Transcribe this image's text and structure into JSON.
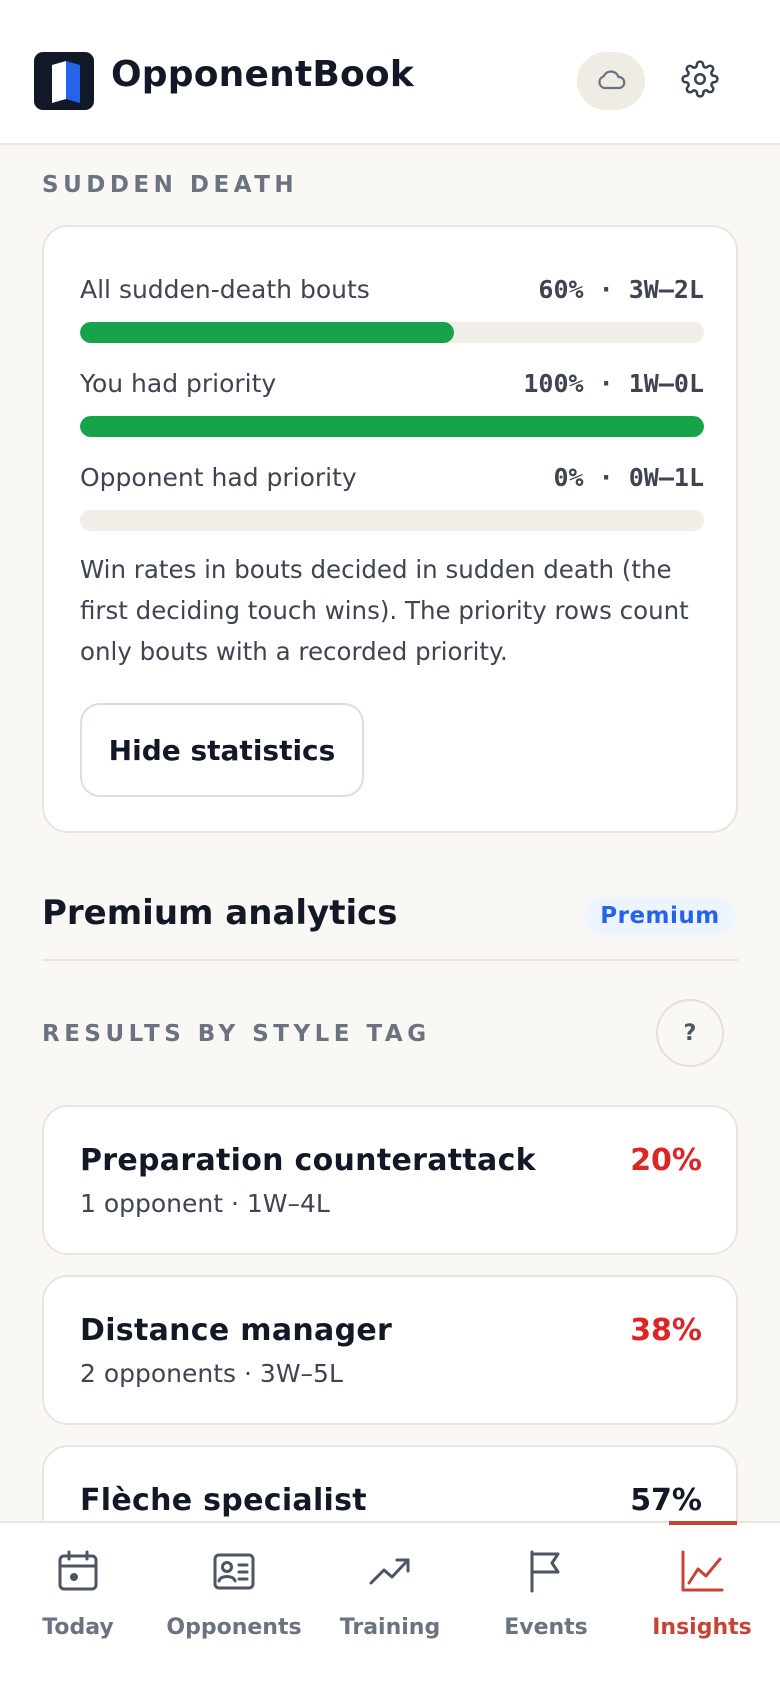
{
  "app": {
    "title": "OpponentBook",
    "accent_color": "#c44536",
    "success_color": "#16a34a",
    "danger_color": "#dc2626",
    "premium_color": "#2563eb"
  },
  "header": {
    "cloud_icon": "cloud-icon",
    "settings_icon": "gear-icon"
  },
  "sudden_death": {
    "section_label": "SUDDEN DEATH",
    "rows": [
      {
        "label": "All sudden-death bouts",
        "value": "60% · 3W–2L",
        "fill": 0.6
      },
      {
        "label": "You had priority",
        "value": "100% · 1W–0L",
        "fill": 1.0
      },
      {
        "label": "Opponent had priority",
        "value": "0% · 0W–1L",
        "fill": 0.0
      }
    ],
    "note": "Win rates in bouts decided in sudden death (the first deciding touch wins). The priority rows count only bouts with a recorded priority.",
    "hide_button": "Hide statistics"
  },
  "premium": {
    "title": "Premium analytics",
    "badge": "Premium",
    "style_tag_label": "RESULTS BY STYLE TAG",
    "help_button": "?",
    "tags": [
      {
        "name": "Preparation counterattack",
        "percent": "20%",
        "summary": "1 opponent · 1W–4L"
      },
      {
        "name": "Distance manager",
        "percent": "38%",
        "summary": "2 opponents · 3W–5L"
      },
      {
        "name": "Flèche specialist",
        "percent": "57%",
        "summary": ""
      }
    ]
  },
  "nav": {
    "items": [
      {
        "label": "Today",
        "icon": "calendar-icon"
      },
      {
        "label": "Opponents",
        "icon": "contact-card-icon"
      },
      {
        "label": "Training",
        "icon": "trending-up-icon"
      },
      {
        "label": "Events",
        "icon": "flag-icon"
      },
      {
        "label": "Insights",
        "icon": "line-chart-icon"
      }
    ],
    "active": "Insights"
  }
}
